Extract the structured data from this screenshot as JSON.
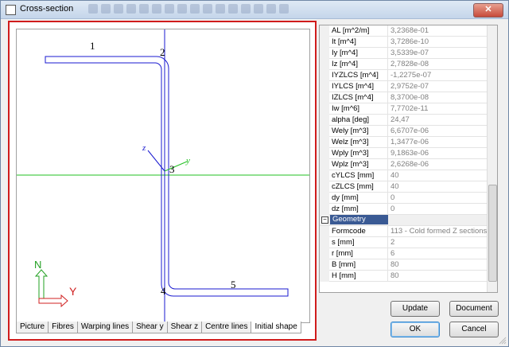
{
  "window": {
    "title": "Cross-section",
    "close_glyph": "✕"
  },
  "figure": {
    "labels": [
      "1",
      "2",
      "3",
      "4",
      "5"
    ],
    "axis_y": "y",
    "axis_z": "z",
    "corner_n": "N",
    "corner_y": "Y"
  },
  "tabs": [
    "Picture",
    "Fibres",
    "Warping lines",
    "Shear y",
    "Shear z",
    "Centre lines",
    "Initial shape"
  ],
  "active_tab": "Initial shape",
  "properties": [
    {
      "name": "AL [m^2/m]",
      "value": "3,2368e-01"
    },
    {
      "name": "It [m^4]",
      "value": "3,7286e-10"
    },
    {
      "name": "Iy [m^4]",
      "value": "3,5339e-07"
    },
    {
      "name": "Iz [m^4]",
      "value": "2,7828e-08"
    },
    {
      "name": "IYZLCS [m^4]",
      "value": "-1,2275e-07"
    },
    {
      "name": "IYLCS [m^4]",
      "value": "2,9752e-07"
    },
    {
      "name": "IZLCS [m^4]",
      "value": "8,3700e-08"
    },
    {
      "name": "Iw [m^6]",
      "value": "7,7702e-11"
    },
    {
      "name": "alpha [deg]",
      "value": "24,47"
    },
    {
      "name": "Wely [m^3]",
      "value": "6,6707e-06"
    },
    {
      "name": "Welz [m^3]",
      "value": "1,3477e-06"
    },
    {
      "name": "Wply [m^3]",
      "value": "9,1863e-06"
    },
    {
      "name": "Wplz [m^3]",
      "value": "2,6268e-06"
    },
    {
      "name": "cYLCS [mm]",
      "value": "40"
    },
    {
      "name": "cZLCS [mm]",
      "value": "40"
    },
    {
      "name": "dy [mm]",
      "value": "0"
    },
    {
      "name": "dz [mm]",
      "value": "0"
    }
  ],
  "geometry_section": {
    "label": "Geometry",
    "expander": "−"
  },
  "geometry": [
    {
      "name": "Formcode",
      "value": "113 - Cold formed Z sections"
    },
    {
      "name": "s [mm]",
      "value": "2"
    },
    {
      "name": "r [mm]",
      "value": "6"
    },
    {
      "name": "B [mm]",
      "value": "80"
    },
    {
      "name": "H [mm]",
      "value": "80"
    }
  ],
  "buttons": {
    "update": "Update",
    "document": "Document",
    "ok": "OK",
    "cancel": "Cancel"
  },
  "colors": {
    "frame_border": "#d01c1c",
    "axis_blue": "#1a1ad0",
    "axis_green": "#22c022",
    "section_header": "#3a5a94"
  }
}
